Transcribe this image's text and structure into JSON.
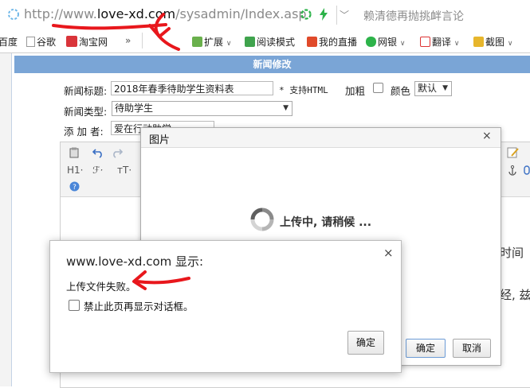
{
  "browser": {
    "url_prefix": "http://www.",
    "url_domain": "love-xd.com",
    "url_path": "/sysadmin/Index.asp",
    "search_hint": "赖清德再抛挑衅言论",
    "bookmarks": {
      "baidu": "百度",
      "google": "谷歌",
      "taobao": "淘宝网",
      "more": "»",
      "extensions": "扩展",
      "reader": "阅读模式",
      "live": "我的直播",
      "bank": "网银",
      "translate": "翻译",
      "screenshot": "截图"
    },
    "accent_colors": {
      "annotation_red": "#e8171c",
      "header_blue": "#7aa5d6"
    }
  },
  "page": {
    "section_title": "新闻修改",
    "form": {
      "title_label": "新闻标题:",
      "title_value": "2018年春季待助学生资料表",
      "html_note": "* 支持HTML",
      "bold_label": "加粗",
      "color_label": "颜色",
      "color_value": "默认",
      "type_label": "新闻类型:",
      "type_value": "待助学生",
      "author_label": "添 加 者:",
      "author_value": "爱在行动助学"
    },
    "editor_toolbar": {
      "heading": "H1·",
      "font_family": "ℱ·",
      "font_size": "тT·"
    },
    "background_text": {
      "right_1": "时间",
      "right_2": "经, 兹"
    }
  },
  "picture_dialog": {
    "title": "图片",
    "close": "×",
    "status": "上传中, 请稍候 ...",
    "ok_label": "确定",
    "cancel_label": "取消"
  },
  "alert_dialog": {
    "title": "www.love-xd.com 显示:",
    "close": "×",
    "message": "上传文件失败。",
    "suppress_label": "禁止此页再显示对话框。",
    "ok_label": "确定"
  }
}
